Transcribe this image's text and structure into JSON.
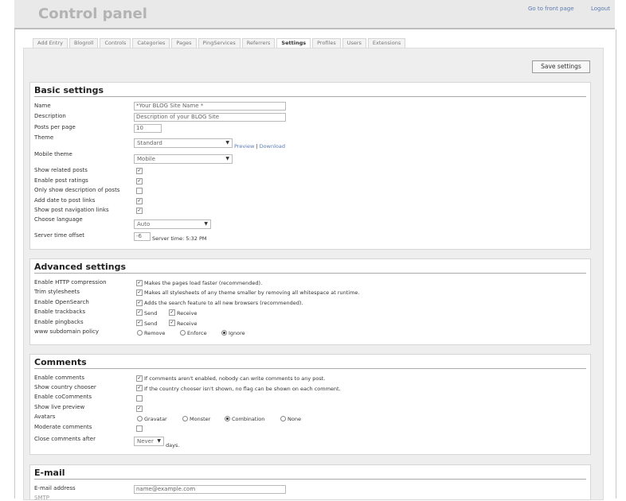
{
  "header": {
    "title": "Control panel",
    "front_link": "Go to front page",
    "logout_link": "Logout"
  },
  "tabs": [
    {
      "label": "Add Entry"
    },
    {
      "label": "Blogroll"
    },
    {
      "label": "Controls"
    },
    {
      "label": "Categories"
    },
    {
      "label": "Pages"
    },
    {
      "label": "PingServices"
    },
    {
      "label": "Referrers"
    },
    {
      "label": "Settings"
    },
    {
      "label": "Profiles"
    },
    {
      "label": "Users"
    },
    {
      "label": "Extensions"
    }
  ],
  "save_label": "Save settings",
  "basic": {
    "title": "Basic settings",
    "name_label": "Name",
    "name_value": "*Your BLOG Site Name  *",
    "description_label": "Description",
    "description_value": "Description of your BLOG Site",
    "posts_per_page_label": "Posts per page",
    "posts_per_page_value": "10",
    "theme_label": "Theme",
    "theme_value": "Standard",
    "preview_link": "Preview",
    "separator": "|",
    "download_link": "Download",
    "mobile_theme_label": "Mobile theme",
    "mobile_theme_value": "Mobile",
    "related_label": "Show related posts",
    "ratings_label": "Enable post ratings",
    "desc_only_label": "Only show description of posts",
    "date_links_label": "Add date to post links",
    "nav_links_label": "Show post navigation links",
    "language_label": "Choose language",
    "language_value": "Auto",
    "offset_label": "Server time offset",
    "offset_value": "-6",
    "server_time": "Server time: 5:32 PM"
  },
  "advanced": {
    "title": "Advanced settings",
    "http_label": "Enable HTTP compression",
    "http_desc": "Makes the pages load faster (recommended).",
    "trim_label": "Trim stylesheets",
    "trim_desc": "Makes all stylesheets of any theme smaller by removing all whitespace at runtime.",
    "opensearch_label": "Enable OpenSearch",
    "opensearch_desc": "Adds the search feature to all new browsers (recommended).",
    "trackbacks_label": "Enable trackbacks",
    "pingbacks_label": "Enable pingbacks",
    "send_label": "Send",
    "receive_label": "Receive",
    "subdomain_label": "www subdomain policy",
    "remove_label": "Remove",
    "enforce_label": "Enforce",
    "ignore_label": "Ignore"
  },
  "comments": {
    "title": "Comments",
    "enable_label": "Enable comments",
    "enable_desc": "If comments aren't enabled, nobody can write comments to any post.",
    "country_label": "Show country chooser",
    "country_desc": "If the country chooser isn't shown, no flag can be shown on each comment.",
    "cocomments_label": "Enable coComments",
    "live_label": "Show live preview",
    "avatars_label": "Avatars",
    "gravatar": "Gravatar",
    "monster": "Monster",
    "combination": "Combination",
    "none": "None",
    "moderate_label": "Moderate comments",
    "close_label": "Close comments after",
    "close_value": "Never",
    "days": "days."
  },
  "email": {
    "title": "E-mail",
    "address_label": "E-mail address",
    "address_placeholder": "name@example.com",
    "smtp_label": "SMTP"
  }
}
